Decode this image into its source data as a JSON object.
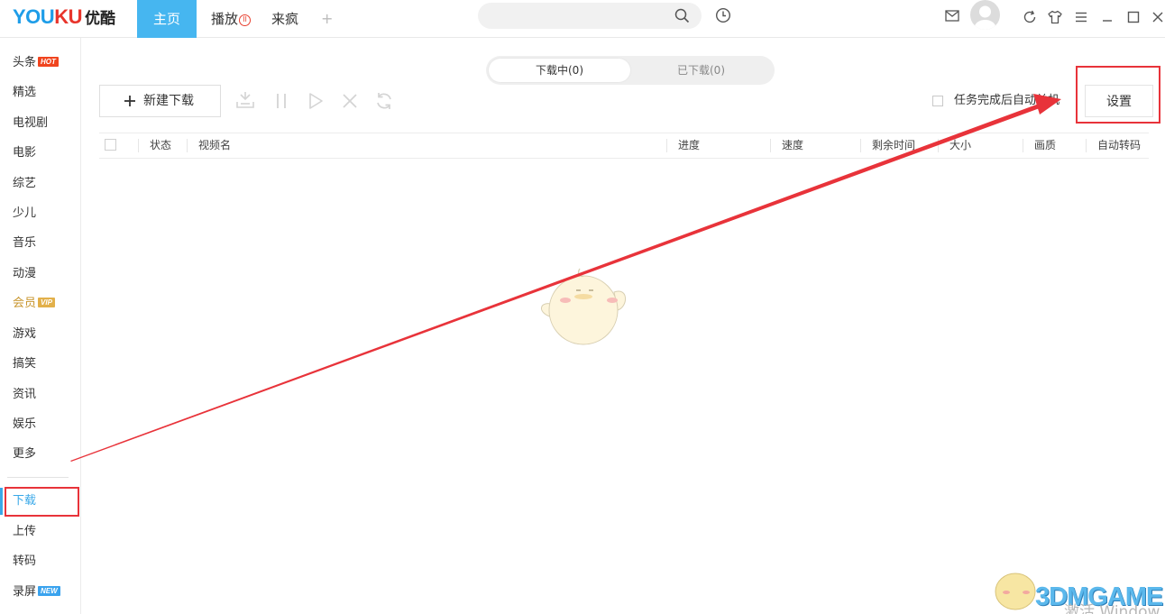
{
  "app": {
    "logo_en": "YOUKU",
    "logo_cn": "优酷"
  },
  "top_nav": {
    "tabs": [
      {
        "label": "主页",
        "active": true
      },
      {
        "label": "播放",
        "badge": "II"
      },
      {
        "label": "来疯"
      }
    ],
    "add_tab_glyph": "+",
    "search": {
      "value": "",
      "placeholder": ""
    },
    "icons": [
      "search-icon",
      "history-clock-icon",
      "mail-icon",
      "avatar",
      "refresh-icon",
      "skin-shirt-icon",
      "menu-icon",
      "minimize-icon",
      "maximize-icon",
      "close-icon"
    ]
  },
  "sidebar": {
    "items": [
      {
        "label": "头条",
        "tag": "HOT"
      },
      {
        "label": "精选"
      },
      {
        "label": "电视剧"
      },
      {
        "label": "电影"
      },
      {
        "label": "综艺"
      },
      {
        "label": "少儿"
      },
      {
        "label": "音乐"
      },
      {
        "label": "动漫"
      },
      {
        "label": "会员",
        "tag": "VIP"
      },
      {
        "label": "游戏"
      },
      {
        "label": "搞笑"
      },
      {
        "label": "资讯"
      },
      {
        "label": "娱乐"
      },
      {
        "label": "更多"
      }
    ],
    "tools": [
      {
        "label": "下载",
        "active": true
      },
      {
        "label": "上传"
      },
      {
        "label": "转码"
      },
      {
        "label": "录屏",
        "tag": "NEW"
      }
    ]
  },
  "download": {
    "segments": [
      {
        "label": "下载中(0)",
        "active": true
      },
      {
        "label": "已下载(0)"
      }
    ],
    "new_download_label": "新建下载",
    "toolbar_icons": [
      "import-icon",
      "pause-icon",
      "play-icon",
      "delete-icon",
      "retry-icon"
    ],
    "auto_shutdown_label": "任务完成后自动关机",
    "auto_shutdown_checked": false,
    "settings_label": "设置",
    "columns": [
      "状态",
      "视频名",
      "进度",
      "速度",
      "剩余时间",
      "大小",
      "画质",
      "自动转码"
    ]
  },
  "watermark": {
    "brand": "3DMGAME",
    "os_notice": "激活 Window"
  },
  "colors": {
    "accent_blue": "#46b6f0",
    "highlight_red": "#e8333a",
    "hot_tag": "#f0441e",
    "vip_gold": "#c8962f",
    "new_tag": "#3aa3ee"
  }
}
